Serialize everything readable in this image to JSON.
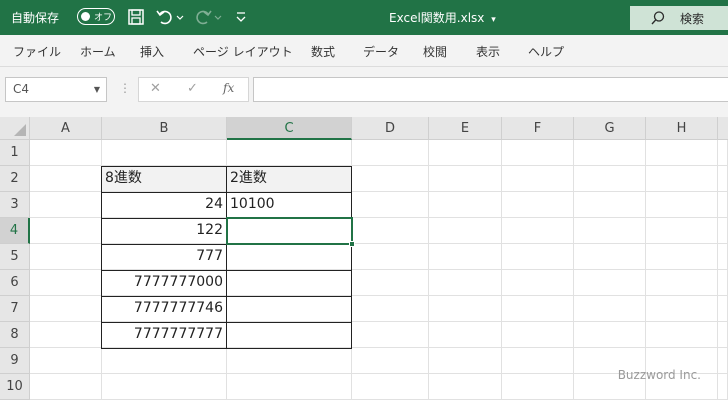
{
  "title_bar": {
    "autosave_label": "自動保存",
    "autosave_toggle": "オフ",
    "document_title": "Excel関数用.xlsx",
    "title_dropdown": "▾",
    "search_label": "検索"
  },
  "menu": [
    "ファイル",
    "ホーム",
    "挿入",
    "ページ レイアウト",
    "数式",
    "データ",
    "校閲",
    "表示",
    "ヘルプ"
  ],
  "formula_bar": {
    "name_box": "C4",
    "name_box_caret": "▼",
    "dots": "⋮",
    "cancel": "✕",
    "enter": "✓",
    "fx": "fx",
    "formula": ""
  },
  "sheet": {
    "columns": [
      "A",
      "B",
      "C",
      "D",
      "E",
      "F",
      "G",
      "H"
    ],
    "rows": [
      "1",
      "2",
      "3",
      "4",
      "5",
      "6",
      "7",
      "8",
      "9",
      "10"
    ],
    "active_cell": "C4",
    "header_col_b": "8進数",
    "header_col_c": "2進数",
    "octal_values": [
      "24",
      "122",
      "777",
      "7777777000",
      "7777777746",
      "7777777777"
    ],
    "binary_values": [
      "10100",
      "",
      "",
      "",
      "",
      ""
    ]
  },
  "colors": {
    "accent": "#217346",
    "table_header_fill": "#f2f2f2"
  },
  "watermark": "Buzzword Inc."
}
